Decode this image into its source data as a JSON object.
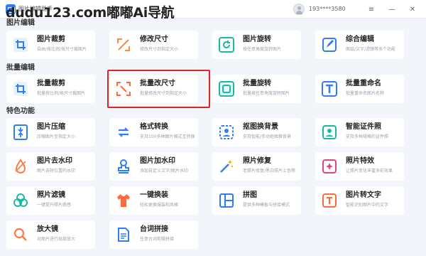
{
  "window": {
    "title": "图片编辑助手",
    "watermark": "dudu123.com嘟嘟Ai导航",
    "user": "193****3580",
    "controls": [
      "≡",
      "—",
      "✕"
    ]
  },
  "sections": [
    {
      "title": "图片编辑"
    },
    {
      "title": "批量编辑"
    },
    {
      "title": "特色功能"
    }
  ],
  "cards": [
    {
      "title": "图片裁剪",
      "desc": "自由/按比例/按尺寸裁图片",
      "icon": "crop-icon"
    },
    {
      "title": "修改尺寸",
      "desc": "修改尺寸到指定大小",
      "icon": "resize-icon"
    },
    {
      "title": "图片旋转",
      "desc": "按任意角度旋转图片",
      "icon": "rotate-icon"
    },
    {
      "title": "综合编辑",
      "desc": "图层/文字/滤镜等多个功能",
      "icon": "edit-icon"
    },
    {
      "title": "批量裁剪",
      "desc": "批量按比例/按尺寸裁图片",
      "icon": "crop-icon"
    },
    {
      "title": "批量改尺寸",
      "desc": "批量修改尺寸到指定大小",
      "icon": "resize-icon"
    },
    {
      "title": "批量旋转",
      "desc": "批量按任意角度旋转图片",
      "icon": "rotate-icon"
    },
    {
      "title": "批量重命名",
      "desc": "批量重命名图片名称",
      "icon": "text-t-icon"
    },
    {
      "title": "图片压缩",
      "desc": "压缩图片至指定大小",
      "icon": "compress-icon"
    },
    {
      "title": "格式转换",
      "desc": "支持100多种图片格式互转换",
      "icon": "convert-icon"
    },
    {
      "title": "抠图换背景",
      "desc": "支持智能/手动抠图换背景",
      "icon": "cutout-icon"
    },
    {
      "title": "智能证件照",
      "desc": "支持多种规格的证件照",
      "icon": "id-photo-icon"
    },
    {
      "title": "图片去水印",
      "desc": "图片去除位置的水印",
      "icon": "remove-watermark-icon"
    },
    {
      "title": "图片加水印",
      "desc": "添加自定义文字/图片水印",
      "icon": "stamp-icon"
    },
    {
      "title": "照片修复",
      "desc": "老照片修复/黑白照片上色等",
      "icon": "magic-wand-icon"
    },
    {
      "title": "照片特效",
      "desc": "让照片变化丰富多彩效果",
      "icon": "effects-icon"
    },
    {
      "title": "照片滤镜",
      "desc": "一键提升照片质感",
      "icon": "filter-icon"
    },
    {
      "title": "一键换装",
      "desc": "轻松更换服装和风格",
      "icon": "clothes-icon"
    },
    {
      "title": "拼图",
      "desc": "提供多种模板与拼接模式",
      "icon": "puzzle-icon"
    },
    {
      "title": "图片转文字",
      "desc": "智能识别图片中的文字",
      "icon": "ocr-icon"
    },
    {
      "title": "放大镜",
      "desc": "对图片进行局部放大",
      "icon": "magnifier-icon"
    },
    {
      "title": "台词拼接",
      "desc": "任意台词剪辑拼接",
      "icon": "subtitle-icon"
    }
  ],
  "colors": {
    "accent": "#2f7cf6",
    "highlight": "#e02424",
    "background": "#f2f5fa"
  }
}
